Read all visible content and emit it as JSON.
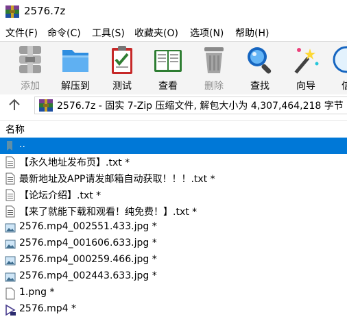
{
  "window": {
    "title": "2576.7z"
  },
  "menu": [
    {
      "label": "文件(F)"
    },
    {
      "label": "命令(C)"
    },
    {
      "label": "工具(S)"
    },
    {
      "label": "收藏夹(O)"
    },
    {
      "label": "选项(N)"
    },
    {
      "label": "帮助(H)"
    }
  ],
  "toolbar": [
    {
      "label": "添加",
      "icon": "add-archive-icon",
      "enabled": false
    },
    {
      "label": "解压到",
      "icon": "extract-folder-icon",
      "enabled": true
    },
    {
      "label": "测试",
      "icon": "test-clipboard-icon",
      "enabled": true
    },
    {
      "label": "查看",
      "icon": "view-book-icon",
      "enabled": true
    },
    {
      "label": "删除",
      "icon": "trash-icon",
      "enabled": false
    },
    {
      "label": "查找",
      "icon": "magnifier-icon",
      "enabled": true
    },
    {
      "label": "向导",
      "icon": "wizard-wand-icon",
      "enabled": true
    },
    {
      "label": "信",
      "icon": "info-icon",
      "enabled": true
    }
  ],
  "address": {
    "text": "2576.7z - 固实 7-Zip 压缩文件, 解包大小为 4,307,464,218 字节"
  },
  "columns": {
    "name": "名称"
  },
  "files": [
    {
      "name": "..",
      "type": "parent",
      "selected": true
    },
    {
      "name": "【永久地址发布页】.txt *",
      "type": "txt"
    },
    {
      "name": "最新地址及APP请发邮箱自动获取！！！.txt *",
      "type": "txt"
    },
    {
      "name": "【论坛介绍】.txt *",
      "type": "txt"
    },
    {
      "name": "【来了就能下载和观看！纯免费！】.txt *",
      "type": "txt"
    },
    {
      "name": "2576.mp4_002551.433.jpg *",
      "type": "img"
    },
    {
      "name": "2576.mp4_001606.633.jpg *",
      "type": "img"
    },
    {
      "name": "2576.mp4_000259.466.jpg *",
      "type": "img"
    },
    {
      "name": "2576.mp4_002443.633.jpg *",
      "type": "img"
    },
    {
      "name": "1.png *",
      "type": "blank"
    },
    {
      "name": "2576.mp4 *",
      "type": "video"
    }
  ],
  "colors": {
    "selection": "#0078d7",
    "toolbar_bg": "#f4f4f4",
    "disabled_text": "#8d8d8d"
  }
}
